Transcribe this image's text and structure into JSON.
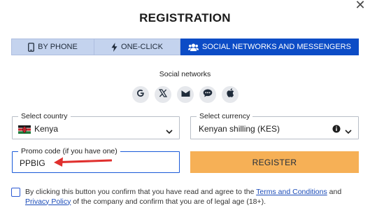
{
  "header": {
    "title": "REGISTRATION",
    "close_symbol": "✕"
  },
  "tabs": [
    {
      "label": "BY PHONE",
      "icon": "phone-icon",
      "active": false
    },
    {
      "label": "ONE-CLICK",
      "icon": "lightning-icon",
      "active": false
    },
    {
      "label": "SOCIAL NETWORKS AND MESSENGERS",
      "icon": "users-icon",
      "active": true
    }
  ],
  "social": {
    "label": "Social networks",
    "icons": [
      "google-icon",
      "x-icon",
      "mail-icon",
      "chat-icon",
      "apple-icon"
    ]
  },
  "country": {
    "label": "Select country",
    "value": "Kenya",
    "flag": "kenya-flag-icon"
  },
  "currency": {
    "label": "Select currency",
    "value": "Kenyan shilling (KES)"
  },
  "promo": {
    "label": "Promo code (if you have one)",
    "value": "PPBIG"
  },
  "register_label": "REGISTER",
  "consent": {
    "text_before": "By clicking this button you confirm that you have read and agree to the ",
    "terms_link": "Terms and Conditions",
    "text_and": " and ",
    "privacy_link": "Privacy Policy",
    "text_after": " of the company and confirm that you are of legal age (18+)."
  },
  "colors": {
    "active_tab": "#0c4cc6",
    "inactive_tab": "#c4d3ee",
    "register_button": "#f6b056",
    "arrow": "#e0302e"
  }
}
